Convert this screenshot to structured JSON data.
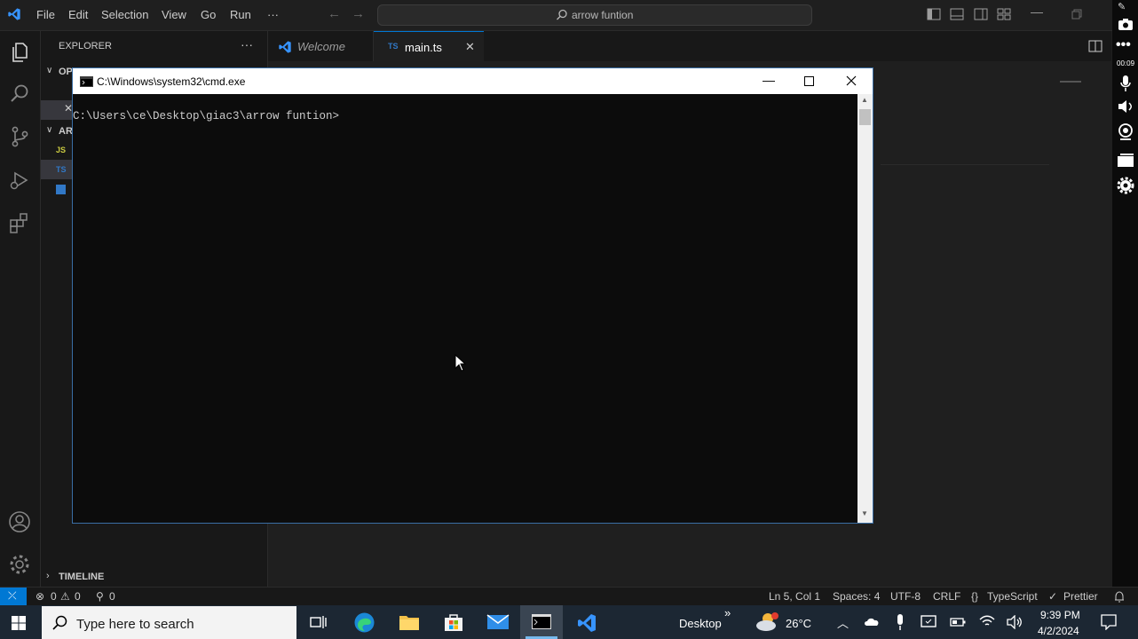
{
  "titlebar": {
    "menu": [
      "File",
      "Edit",
      "Selection",
      "View",
      "Go",
      "Run",
      "···"
    ],
    "search_text": "arrow funtion"
  },
  "sidebar": {
    "title": "EXPLORER",
    "more": "···",
    "section_open": "OP",
    "section_folder": "AR",
    "file_icons": [
      "JS",
      "TS"
    ],
    "timeline": "TIMELINE"
  },
  "tabs": [
    {
      "label": "Welcome",
      "icon": "vscode-logo-icon"
    },
    {
      "label": "main.ts",
      "icon": "TS",
      "active": true
    }
  ],
  "cmd": {
    "title": "C:\\Windows\\system32\\cmd.exe",
    "prompt": "C:\\Users\\ce\\Desktop\\giac3\\arrow funtion>"
  },
  "statusbar": {
    "errors": "0",
    "warnings": "0",
    "ports": "0",
    "position": "Ln 5, Col 1",
    "spaces": "Spaces: 4",
    "encoding": "UTF-8",
    "eol": "CRLF",
    "language": "TypeScript",
    "formatter": "Prettier"
  },
  "recorder": {
    "timer": "00:09"
  },
  "taskbar": {
    "search_placeholder": "Type here to search",
    "desktop_label": "Desktop",
    "chevron": "»",
    "temperature": "26°C",
    "time": "9:39 PM",
    "date": "4/2/2024"
  },
  "colors": {
    "vscode_blue": "#3794ff",
    "accent": "#0078d4",
    "remote": "#0e639c",
    "cmd_bg": "#0c0c0c"
  }
}
